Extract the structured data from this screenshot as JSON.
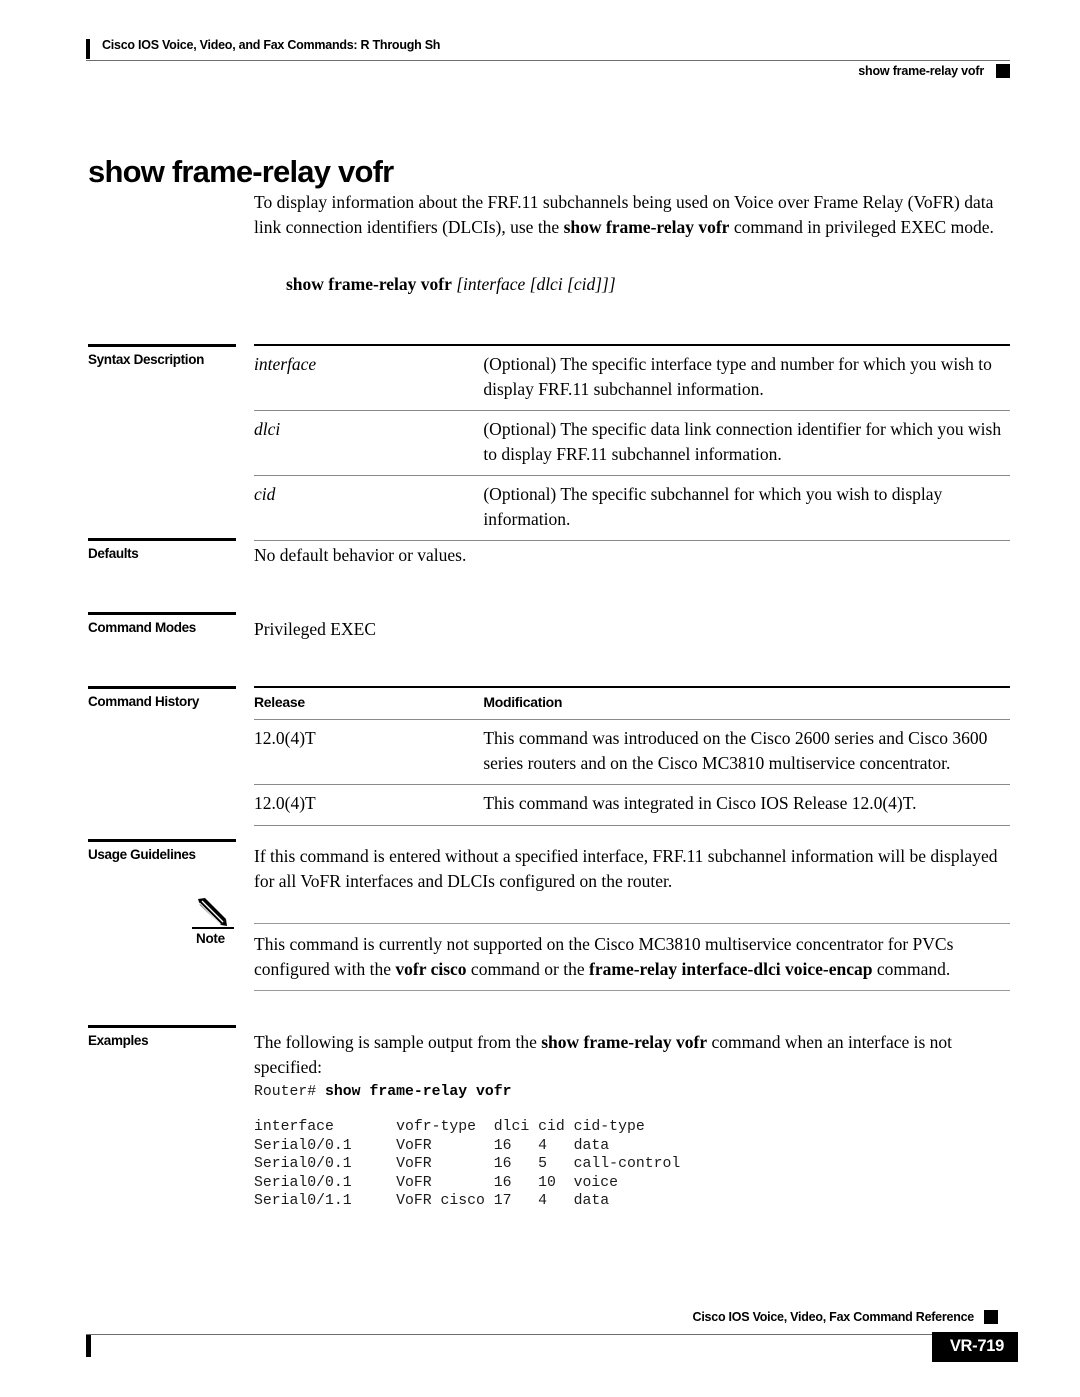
{
  "header": {
    "book_title": "Cisco IOS Voice, Video, and Fax Commands: R Through Sh",
    "running_command": "show frame-relay vofr"
  },
  "command": {
    "title": "show frame-relay vofr",
    "description_part1": "To display information about the FRF.11 subchannels being used on Voice over Frame Relay (VoFR) data link connection identifiers (DLCIs), use the ",
    "description_bold": "show frame-relay vofr",
    "description_part2": " command in privileged EXEC mode.",
    "syntax_bold": "show frame-relay vofr",
    "syntax_optional": " [interface [dlci [cid]]]"
  },
  "sections": {
    "syntax_description": {
      "label": "Syntax Description",
      "rows": [
        {
          "term": "interface",
          "definition": "(Optional) The specific interface type and number for which you wish to display FRF.11 subchannel information."
        },
        {
          "term": "dlci",
          "definition": "(Optional) The specific data link connection identifier for which you wish to display FRF.11 subchannel information."
        },
        {
          "term": "cid",
          "definition": "(Optional) The specific subchannel for which you wish to display information."
        }
      ]
    },
    "defaults": {
      "label": "Defaults",
      "text": "No default behavior or values."
    },
    "command_modes": {
      "label": "Command Modes",
      "text": "Privileged EXEC"
    },
    "command_history": {
      "label": "Command History",
      "columns": [
        "Release",
        "Modification"
      ],
      "rows": [
        {
          "release": "12.0(4)T",
          "modification": "This command was introduced on the Cisco 2600 series and Cisco 3600 series routers and on the Cisco MC3810 multiservice concentrator."
        },
        {
          "release": "12.0(4)T",
          "modification": "This command was integrated in Cisco IOS Release 12.0(4)T."
        }
      ]
    },
    "usage_guidelines": {
      "label": "Usage Guidelines",
      "text": "If this command is entered without a specified interface, FRF.11 subchannel information will be displayed for all VoFR interfaces and DLCIs configured on the router."
    },
    "note": {
      "label": "Note",
      "icon": "pencil-icon",
      "text_part1": "This command is currently not supported on the Cisco MC3810 multiservice concentrator for PVCs configured with the ",
      "bold1": "vofr cisco",
      "text_part2": " command or the ",
      "bold2": "frame-relay interface-dlci voice-encap",
      "text_part3": " command."
    },
    "examples": {
      "label": "Examples",
      "intro_part1": "The following is sample output from the ",
      "intro_bold": "show frame-relay vofr",
      "intro_part2": " command when an interface is not specified:",
      "prompt": "Router# ",
      "prompt_command": "show frame-relay vofr",
      "output_columns": [
        "interface",
        "vofr-type",
        "dlci",
        "cid",
        "cid-type"
      ],
      "output_rows": [
        [
          "Serial0/0.1",
          "VoFR",
          "16",
          "4",
          "data"
        ],
        [
          "Serial0/0.1",
          "VoFR",
          "16",
          "5",
          "call-control"
        ],
        [
          "Serial0/0.1",
          "VoFR",
          "16",
          "10",
          "voice"
        ],
        [
          "Serial0/1.1",
          "VoFR cisco",
          "17",
          "4",
          "data"
        ]
      ]
    }
  },
  "footer": {
    "reference_title": "Cisco IOS Voice, Video, Fax Command Reference",
    "page_number": "VR-719"
  }
}
